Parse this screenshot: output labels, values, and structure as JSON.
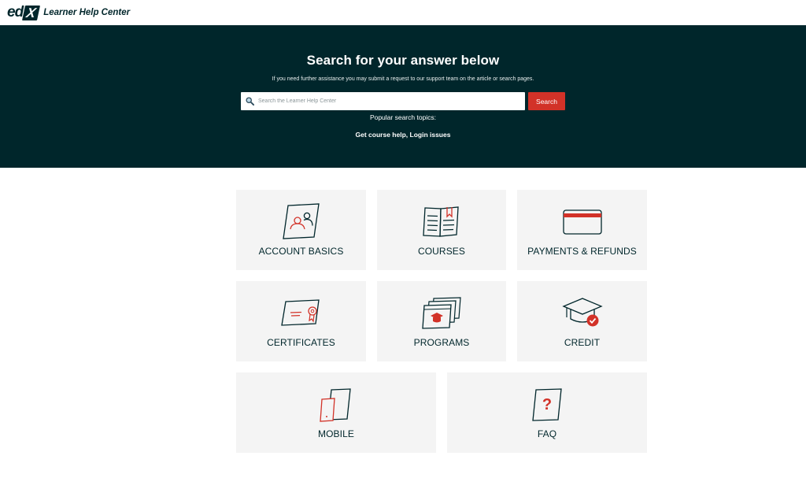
{
  "header": {
    "logo_ed": "ed",
    "logo_x": "X",
    "logo_text": "Learner Help Center"
  },
  "hero": {
    "title": "Search for your answer below",
    "subtitle": "If you need further assistance you may submit a request to our support team on the article or search pages.",
    "search_placeholder": "Search the Learner Help Center",
    "search_button": "Search",
    "popular_label": "Popular search topics:",
    "popular_links": [
      "Get course help",
      "Login issues"
    ],
    "popular_separator": ", "
  },
  "categories": [
    {
      "label": "ACCOUNT BASICS",
      "icon": "account-icon"
    },
    {
      "label": "COURSES",
      "icon": "book-icon"
    },
    {
      "label": "PAYMENTS & REFUNDS",
      "icon": "credit-card-icon"
    },
    {
      "label": "CERTIFICATES",
      "icon": "certificate-icon"
    },
    {
      "label": "PROGRAMS",
      "icon": "programs-icon"
    },
    {
      "label": "CREDIT",
      "icon": "graduation-cap-icon"
    },
    {
      "label": "MOBILE",
      "icon": "mobile-icon"
    },
    {
      "label": "FAQ",
      "icon": "faq-icon"
    }
  ],
  "colors": {
    "brand_dark": "#00262b",
    "accent_red": "#d23228",
    "card_bg": "#f4f4f4"
  }
}
